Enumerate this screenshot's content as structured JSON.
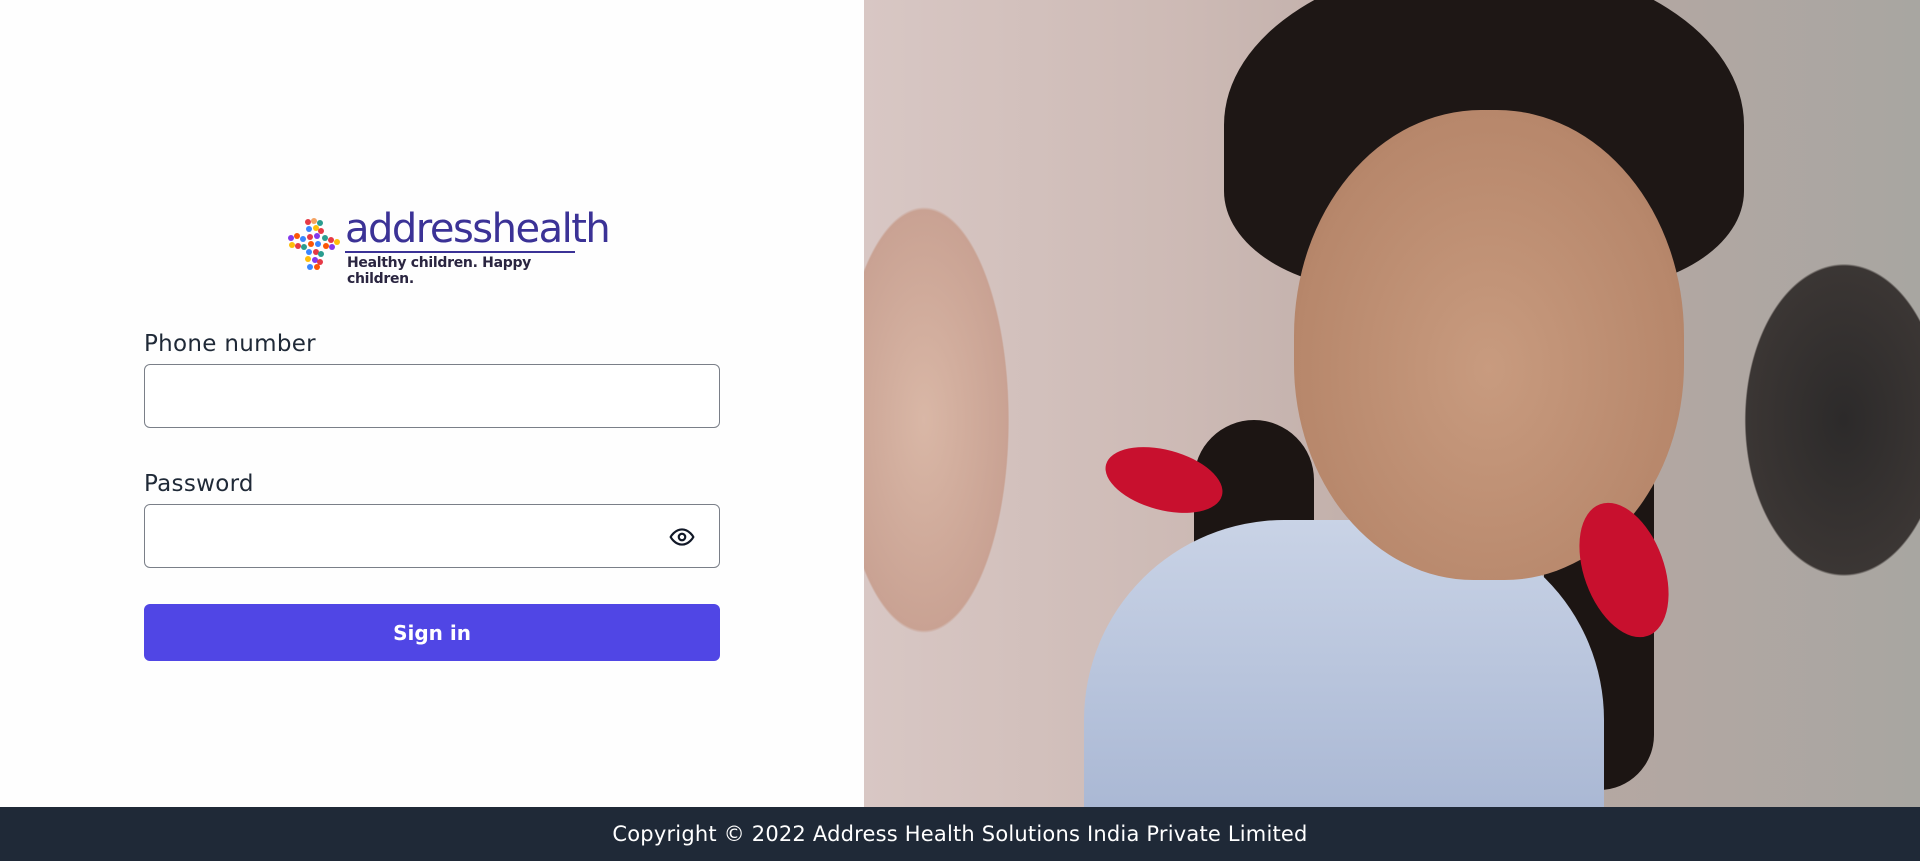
{
  "brand": {
    "name": "addresshealth",
    "tagline": "Healthy children. Happy children.",
    "primary_color": "#5046e5",
    "logo_text_color": "#3b3296"
  },
  "login_form": {
    "phone": {
      "label": "Phone number",
      "value": "",
      "placeholder": ""
    },
    "password": {
      "label": "Password",
      "value": "",
      "placeholder": "",
      "toggle_icon": "eye-icon"
    },
    "submit_label": "Sign in"
  },
  "hero_image": {
    "alt": "Smiling school girl with red ribbons"
  },
  "footer": {
    "text": "Copyright © 2022 Address Health Solutions India Private Limited",
    "background": "#1f2937"
  }
}
